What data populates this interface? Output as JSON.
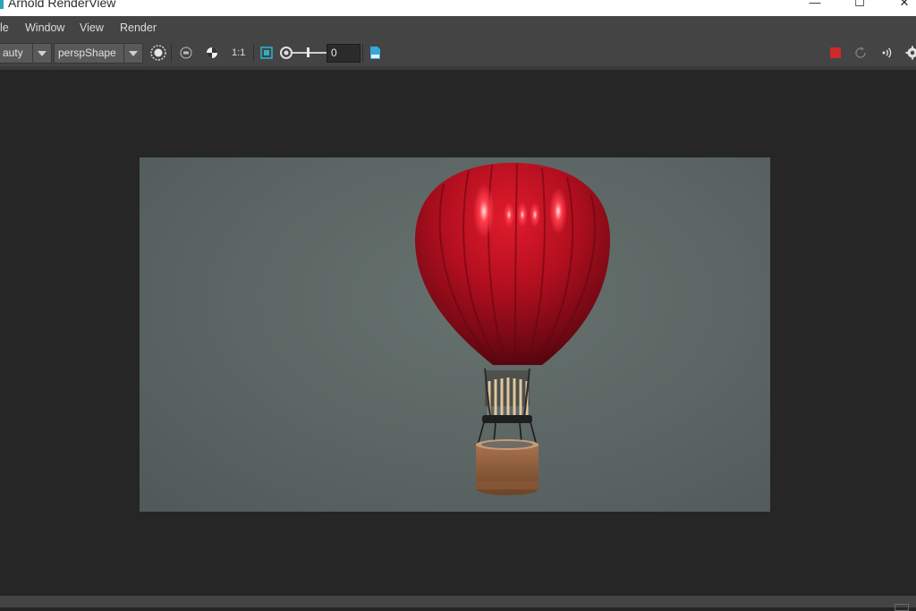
{
  "window": {
    "title": "Arnold RenderView",
    "minimize": "—",
    "maximize": "☐",
    "close": "✕"
  },
  "menu": {
    "items": [
      "le",
      "Window",
      "View",
      "Render"
    ]
  },
  "toolbar": {
    "aov_value": "auty",
    "camera_value": "perspShape",
    "ratio_label": "1:1",
    "exposure_value": "0",
    "stop_color": "#cc2a2a"
  },
  "render": {
    "subject": "hot-air-balloon",
    "balloon_color": "#b0101e",
    "background_color": "#5b6563"
  },
  "icons": [
    "region-icon",
    "crop-icon",
    "channel-icon",
    "ratio-icon",
    "display-fit-icon",
    "exposure-icon",
    "log-icon",
    "stop-icon",
    "refresh-icon",
    "debug-icon",
    "settings-icon"
  ]
}
